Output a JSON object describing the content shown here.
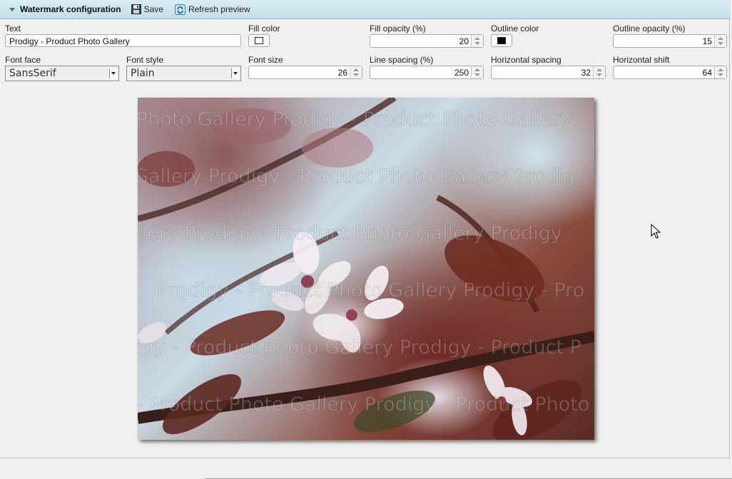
{
  "toolbar": {
    "title": "Watermark configuration",
    "save_label": "Save",
    "refresh_label": "Refresh preview"
  },
  "text_field": {
    "label": "Text",
    "value": "Prodigy - Product Photo Gallery"
  },
  "fill_color": {
    "label": "Fill color",
    "color": "#ffffff"
  },
  "fill_opacity": {
    "label": "Fill opacity (%)",
    "value": "20"
  },
  "outline_color": {
    "label": "Outline color",
    "color": "#000000"
  },
  "outline_opacity": {
    "label": "Outline opacity (%)",
    "value": "15"
  },
  "font_face": {
    "label": "Font face",
    "value": "SansSerif"
  },
  "font_style": {
    "label": "Font style",
    "value": "Plain"
  },
  "font_size": {
    "label": "Font size",
    "value": "26"
  },
  "line_spacing": {
    "label": "Line spacing (%)",
    "value": "250"
  },
  "horizontal_spacing": {
    "label": "Horizontal spacing",
    "value": "32"
  },
  "horizontal_shift": {
    "label": "Horizontal shift",
    "value": "64"
  },
  "preview": {
    "watermark_rows": [
      "Photo Gallery    Prodigy - Product Photo Gallery",
      "Gallery    Prodigy - Product Photo Gallery    Prodig",
      "llery    Prodigy - Product Photo Gallery    Prodigy",
      "Prodigy - Product Photo Gallery    Prodigy - Pro",
      "igy - Product Photo Gallery    Prodigy - Product P",
      "- Product Photo Gallery    Prodigy - Product Photo"
    ]
  }
}
